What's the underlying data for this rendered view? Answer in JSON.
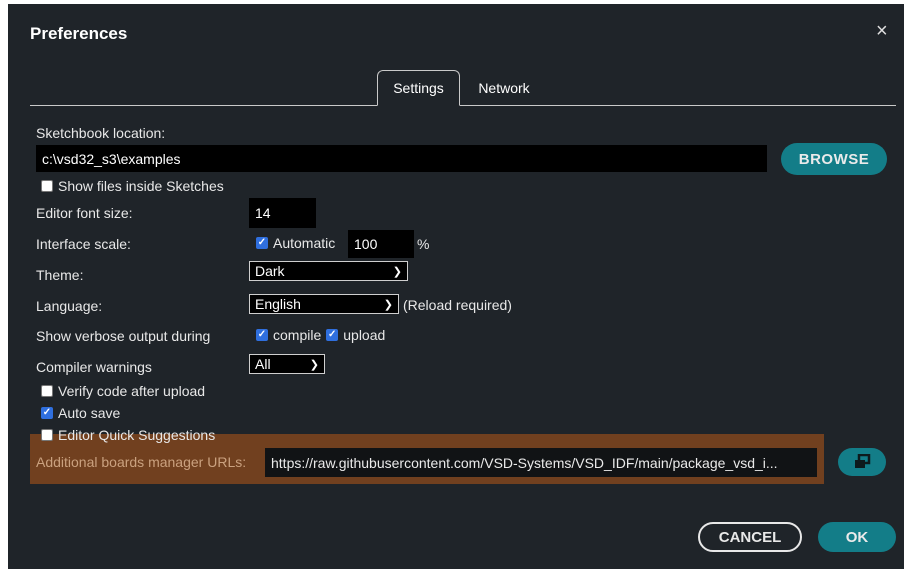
{
  "dialog": {
    "title": "Preferences",
    "close_icon": "×"
  },
  "tabs": [
    {
      "label": "Settings",
      "active": true
    },
    {
      "label": "Network",
      "active": false
    }
  ],
  "sketchbook": {
    "label": "Sketchbook location:",
    "value": "c:\\vsd32_s3\\examples",
    "browse_label": "BROWSE"
  },
  "show_files": {
    "label": "Show files inside Sketches",
    "checked": false
  },
  "font_size": {
    "label": "Editor font size:",
    "value": "14"
  },
  "interface_scale": {
    "label": "Interface scale:",
    "automatic_label": "Automatic",
    "automatic_checked": true,
    "value": "100",
    "unit": "%"
  },
  "theme": {
    "label": "Theme:",
    "selected": "Dark"
  },
  "language": {
    "label": "Language:",
    "selected": "English",
    "note": "(Reload required)"
  },
  "verbose": {
    "label": "Show verbose output during",
    "compile_label": "compile",
    "compile_checked": true,
    "upload_label": "upload",
    "upload_checked": true
  },
  "compiler_warnings": {
    "label": "Compiler warnings",
    "selected": "All"
  },
  "verify": {
    "label": "Verify code after upload",
    "checked": false
  },
  "auto_save": {
    "label": "Auto save",
    "checked": true
  },
  "quick_suggestions": {
    "label": "Editor Quick Suggestions",
    "checked": false
  },
  "boards_urls": {
    "label": "Additional boards manager URLs:",
    "value": "https://raw.githubusercontent.com/VSD-Systems/VSD_IDF/main/package_vsd_i..."
  },
  "footer": {
    "cancel_label": "CANCEL",
    "ok_label": "OK"
  },
  "colors": {
    "background": "#1f2429",
    "accent": "#137d88",
    "highlight": "#71401f",
    "checkbox": "#2f6fde"
  }
}
